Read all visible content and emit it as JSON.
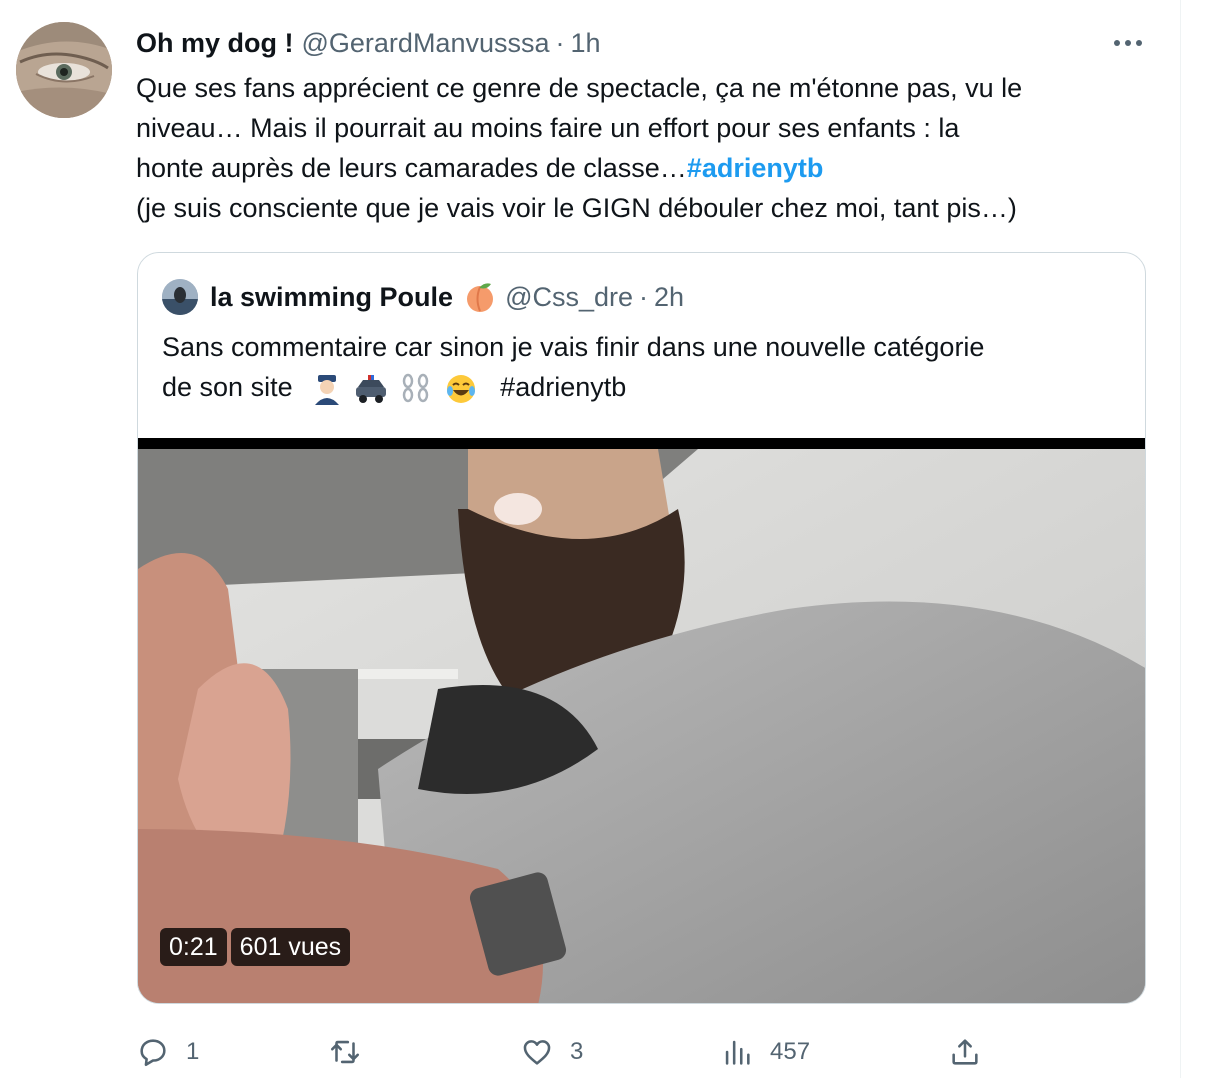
{
  "tweet": {
    "author": {
      "display_name": "Oh my dog !",
      "handle": "@GerardManvusssa",
      "time": "1h",
      "avatar_icon": "eye-closeup-avatar"
    },
    "text_lines": [
      "Que ses fans apprécient ce genre de spectacle, ça ne m'étonne pas, vu le",
      "niveau… Mais il pourrait au moins faire un effort pour ses enfants : la",
      "honte auprès de leurs camarades de classe…"
    ],
    "hashtag": "#adrienytb",
    "last_line": "(je suis consciente que je vais voir le GIGN débouler chez moi, tant pis…)",
    "more_icon": "more-dots-icon"
  },
  "quote": {
    "display_name": "la swimming Poule",
    "name_emoji": "peach-icon",
    "handle": "@Css_dre",
    "time": "2h",
    "text_line1": "Sans commentaire car sinon je vais finir dans une nouvelle catégorie",
    "text_line2_prefix": "de son site",
    "emojis": [
      "police-officer-icon",
      "police-car-icon",
      "chains-icon",
      "laughing-tears-icon"
    ],
    "hashtag": "#adrienytb",
    "video": {
      "duration": "0:21",
      "views": "601 vues"
    }
  },
  "actions": {
    "reply_count": "1",
    "retweet_count": "",
    "like_count": "3",
    "view_count": "457",
    "icons": [
      "reply-icon",
      "retweet-icon",
      "like-icon",
      "views-icon",
      "share-icon"
    ]
  },
  "colors": {
    "link": "#1d9bf0",
    "secondary_text": "#536471",
    "border": "#cfd9de"
  }
}
